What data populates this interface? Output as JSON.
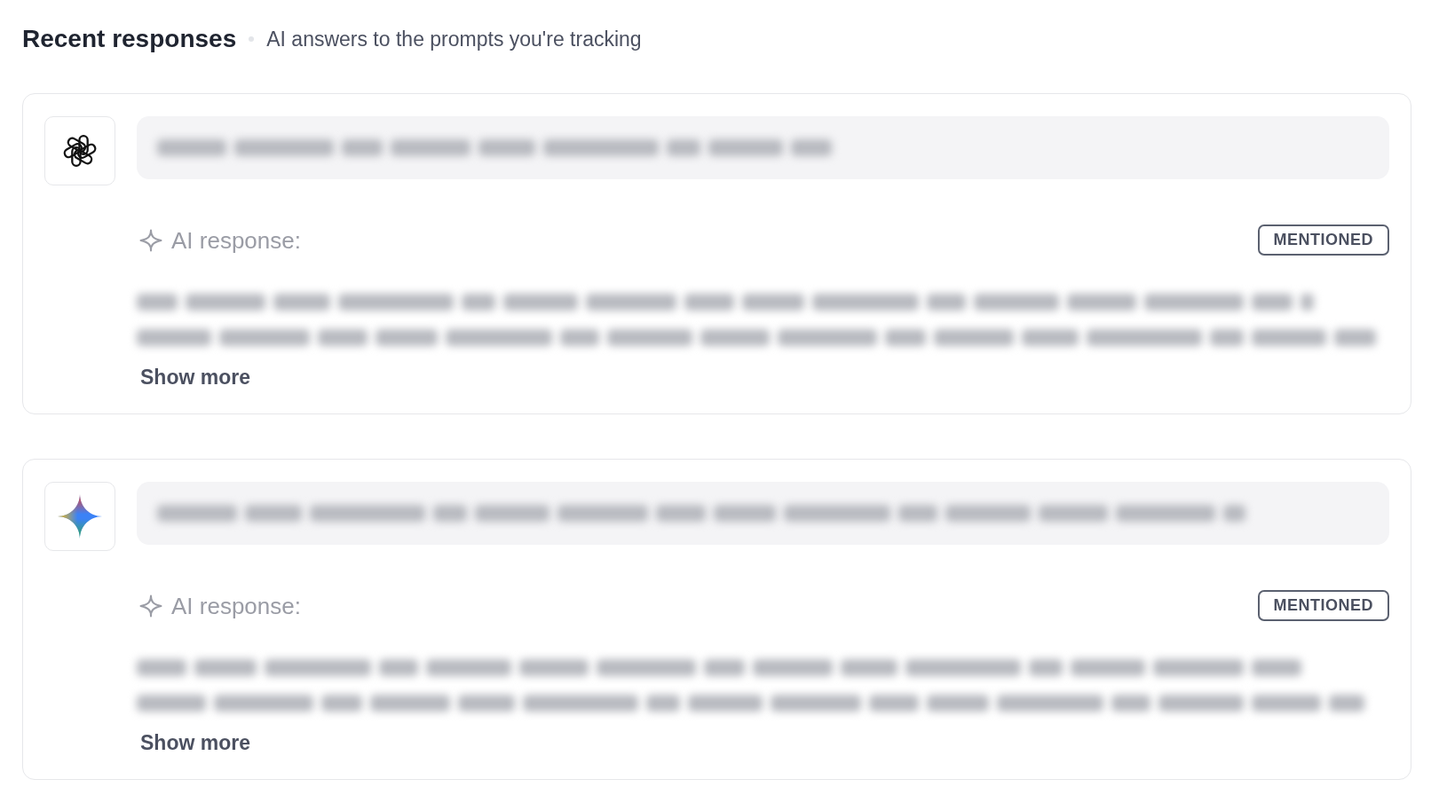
{
  "header": {
    "title": "Recent responses",
    "subtitle": "AI answers to the prompts you're tracking"
  },
  "responses": [
    {
      "kind": "chatgpt",
      "label": "AI response:",
      "badge": "MENTIONED",
      "action": "Show more"
    },
    {
      "kind": "gemini",
      "label": "AI response:",
      "badge": "MENTIONED",
      "action": "Show more"
    }
  ]
}
